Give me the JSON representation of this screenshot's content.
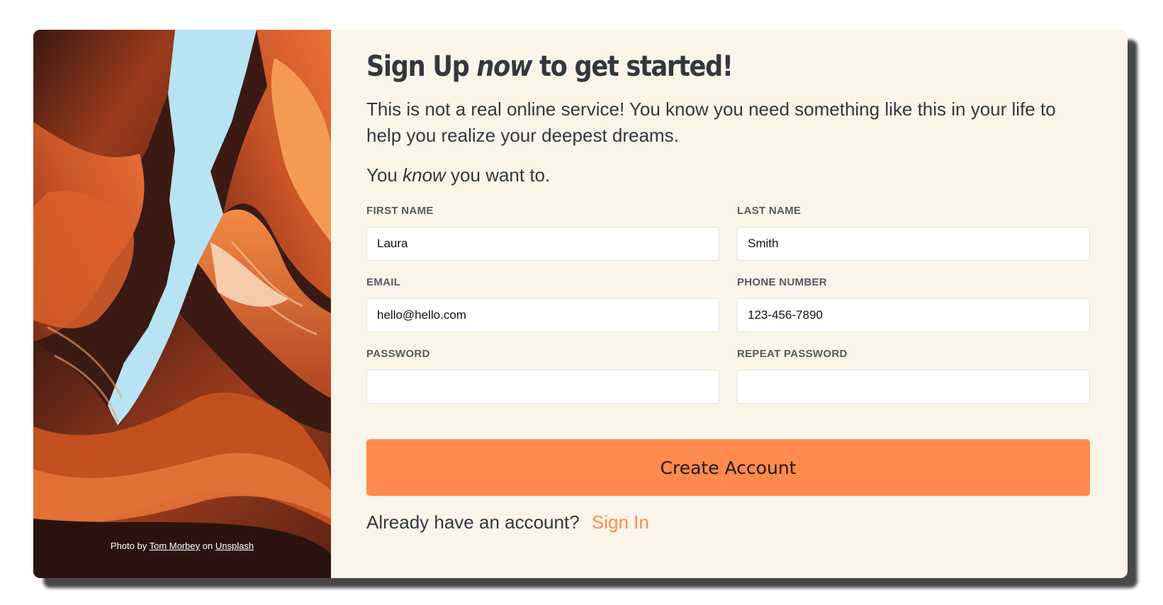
{
  "photo": {
    "credit_prefix": "Photo by",
    "credit_author": "Tom Morbey",
    "credit_middle": "on",
    "credit_site": "Unsplash"
  },
  "header": {
    "title_start": "Sign Up",
    "title_emphasis": "now",
    "title_end": "to get started!"
  },
  "intro": "This is not a real online service! You know you need something like this in your life to help you realize your deepest dreams.",
  "sub": {
    "start": "You",
    "emphasis": "know",
    "end": "you want to."
  },
  "form": {
    "first_name": {
      "label": "FIRST NAME",
      "value": "Laura"
    },
    "last_name": {
      "label": "LAST NAME",
      "value": "Smith"
    },
    "email": {
      "label": "EMAIL",
      "value": "hello@hello.com"
    },
    "phone": {
      "label": "PHONE NUMBER",
      "value": "123-456-7890"
    },
    "password": {
      "label": "PASSWORD",
      "value": ""
    },
    "repeat_password": {
      "label": "REPEAT PASSWORD",
      "value": ""
    },
    "submit_label": "Create Account"
  },
  "signin": {
    "prompt": "Already have an account?",
    "link": "Sign In"
  },
  "colors": {
    "accent": "#ff8a4d",
    "panel_bg": "#f9f6e9",
    "text": "#32383d"
  }
}
